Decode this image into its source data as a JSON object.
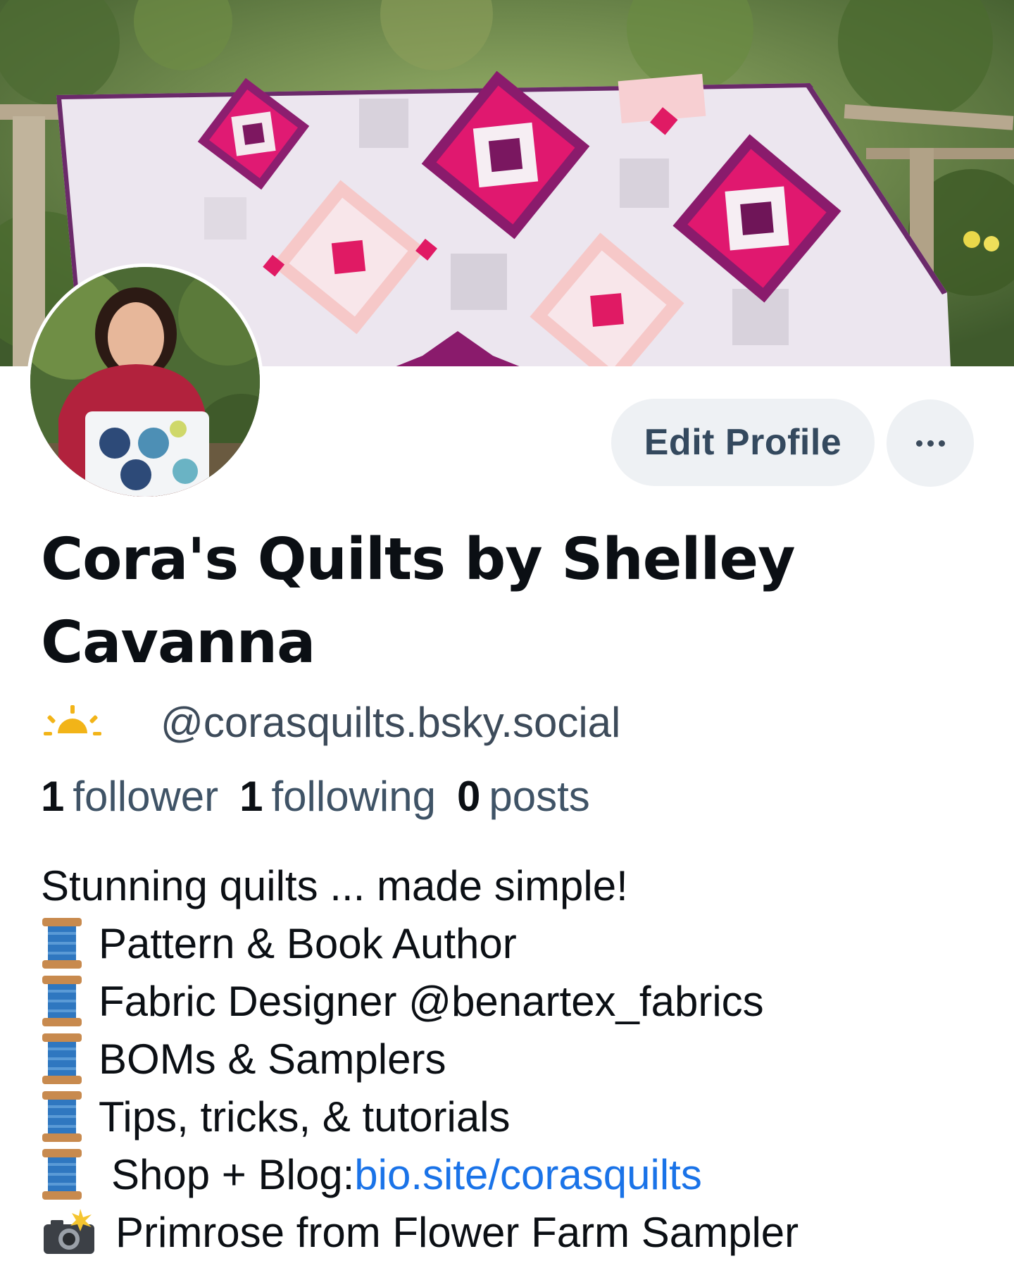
{
  "profile": {
    "edit_label": "Edit Profile",
    "more_label": "More options",
    "display_name": "Cora's Quilts by Shelley Cavanna",
    "handle": "@corasquilts.bsky.social",
    "handle_emoji": "sun-icon"
  },
  "stats": [
    {
      "count": "1",
      "label": "follower"
    },
    {
      "count": "1",
      "label": "following"
    },
    {
      "count": "0",
      "label": "posts"
    }
  ],
  "bio": {
    "line1": "Stunning quilts ... made simple!",
    "line2": "Pattern & Book Author",
    "line3": "Fabric Designer @benartex_fabrics",
    "line4": "BOMs & Samplers",
    "line5": "Tips, tricks, & tutorials",
    "line6_prefix": "Shop + Blog: ",
    "line6_link": "bio.site/corasquilts",
    "line7": "Primrose from Flower Farm Sampler",
    "bullet_icon": "spool-of-thread-icon",
    "photo_icon": "camera-flash-icon"
  },
  "colors": {
    "link": "#1a73e8",
    "stat_label": "#3f5366",
    "button_bg": "#eef1f4",
    "button_text": "#34495e"
  }
}
